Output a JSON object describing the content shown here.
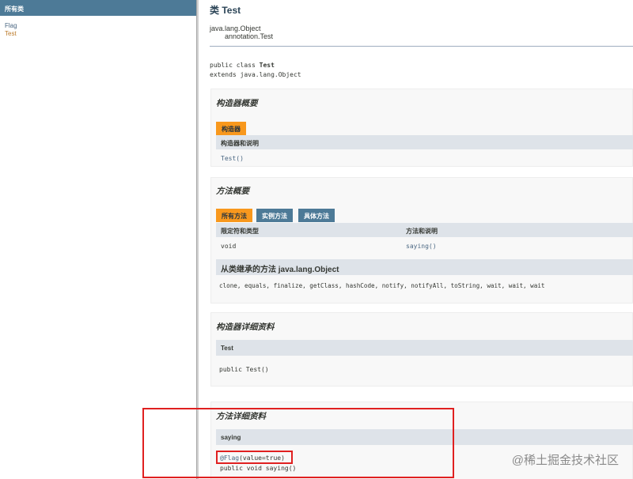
{
  "sidebar": {
    "header": "所有类",
    "classes": [
      "Flag",
      "Test"
    ]
  },
  "class_header": {
    "title": "类 Test",
    "inheritance": [
      "java.lang.Object",
      "annotation.Test"
    ],
    "declaration_line1": "public class Test",
    "declaration_line2": "extends java.lang.Object"
  },
  "constructor_summary": {
    "title": "构造器概要",
    "tab": "构造器",
    "column": "构造器和说明",
    "row": "Test()"
  },
  "method_summary": {
    "title": "方法概要",
    "tabs": [
      "所有方法",
      "实例方法",
      "具体方法"
    ],
    "columns": [
      "限定符和类型",
      "方法和说明"
    ],
    "row": {
      "type": "void",
      "method": "saying()"
    },
    "inherited_title": "从类继承的方法 java.lang.Object",
    "inherited_methods": "clone, equals, finalize, getClass, hashCode, notify, notifyAll, toString, wait, wait, wait"
  },
  "constructor_detail": {
    "title": "构造器详细资料",
    "name": "Test",
    "signature": "public  Test()"
  },
  "method_detail": {
    "title": "方法详细资料",
    "name": "saying",
    "annotation": "@Flag(value=true)",
    "signature": "public  void  saying()"
  },
  "watermark": "@稀土掘金技术社区",
  "colors": {
    "nav_blue": "#4d7a97",
    "tab_orange": "#f8981d",
    "header_gray": "#dee3e9",
    "highlight_red": "#e02020"
  }
}
